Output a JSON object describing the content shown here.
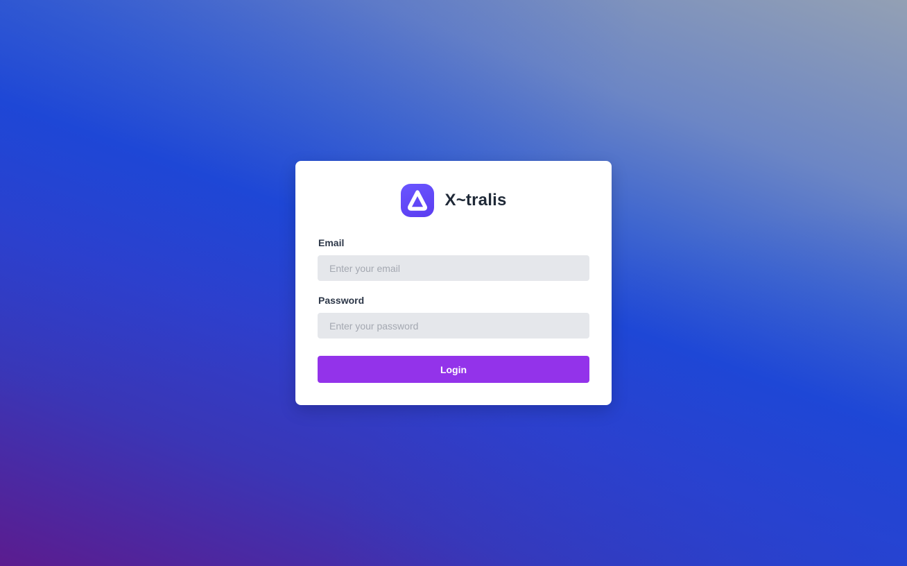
{
  "brand": {
    "name": "X~tralis",
    "logo_icon": "triangle-a-logo-icon",
    "logo_color": "#5b3df0"
  },
  "form": {
    "email_label": "Email",
    "email_placeholder": "Enter your email",
    "email_value": "",
    "password_label": "Password",
    "password_placeholder": "Enter your password",
    "password_value": "",
    "login_label": "Login"
  },
  "colors": {
    "accent": "#9333ea",
    "input_bg": "#e5e7eb",
    "card_bg": "#ffffff"
  }
}
